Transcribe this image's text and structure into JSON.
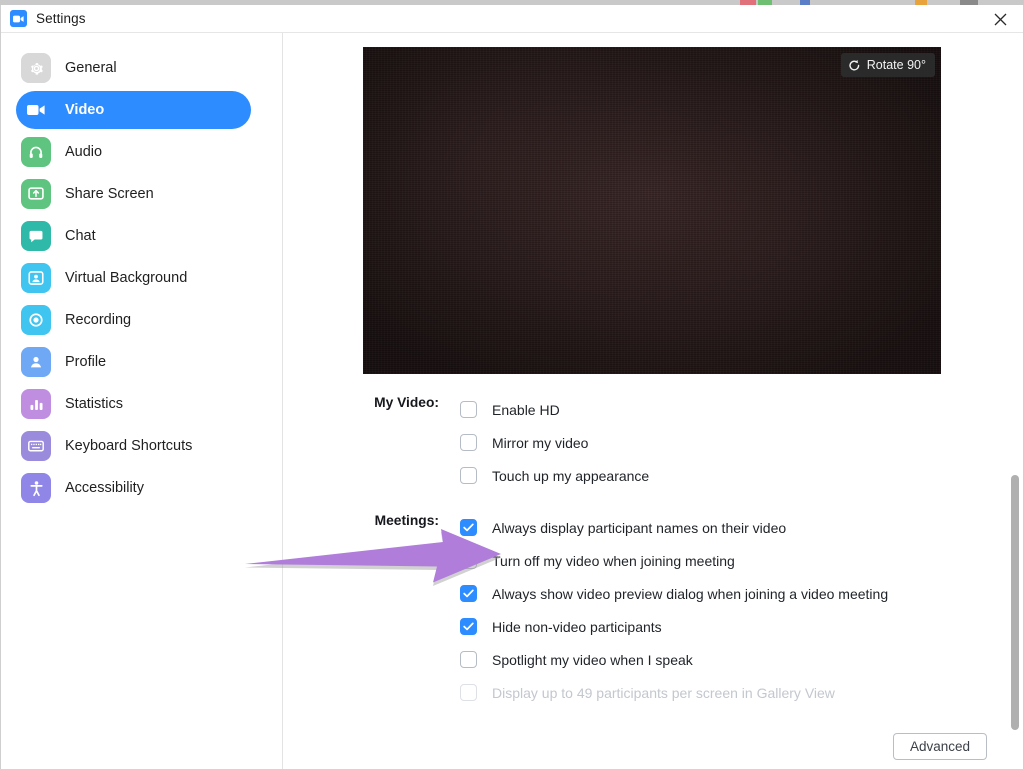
{
  "window": {
    "title": "Settings",
    "title_icon": "zoom-video-icon",
    "close_icon": "close-icon"
  },
  "colors": {
    "accent": "#2D8CFF",
    "arrow": "#b07ddb",
    "video_bg": "#2b1c1c",
    "disabled_text": "#c3c7ce"
  },
  "sidebar": {
    "items": [
      {
        "label": "General",
        "icon": "gear-icon",
        "icon_bg": "#d8d8d8",
        "active": false
      },
      {
        "label": "Video",
        "icon": "camera-icon",
        "icon_bg": "#2D8CFF",
        "active": true
      },
      {
        "label": "Audio",
        "icon": "headset-icon",
        "icon_bg": "#5ec47f",
        "active": false
      },
      {
        "label": "Share Screen",
        "icon": "upload-icon",
        "icon_bg": "#5ec47f",
        "active": false
      },
      {
        "label": "Chat",
        "icon": "chat-icon",
        "icon_bg": "#2fb9a8",
        "active": false
      },
      {
        "label": "Virtual Background",
        "icon": "person-card-icon",
        "icon_bg": "#40c4f0",
        "active": false
      },
      {
        "label": "Recording",
        "icon": "record-icon",
        "icon_bg": "#40c4f0",
        "active": false
      },
      {
        "label": "Profile",
        "icon": "person-icon",
        "icon_bg": "#6fa8f5",
        "active": false
      },
      {
        "label": "Statistics",
        "icon": "bar-chart-icon",
        "icon_bg": "#c08ee0",
        "active": false
      },
      {
        "label": "Keyboard Shortcuts",
        "icon": "keyboard-icon",
        "icon_bg": "#9b8bdd",
        "active": false
      },
      {
        "label": "Accessibility",
        "icon": "accessibility-icon",
        "icon_bg": "#8f86e8",
        "active": false
      }
    ]
  },
  "main": {
    "video_preview": {
      "rotate_button_label": "Rotate 90°",
      "rotate_icon": "rotate-ccw-icon"
    },
    "groups": [
      {
        "label": "My Video:",
        "items": [
          {
            "label": "Enable HD",
            "checked": false,
            "disabled": false
          },
          {
            "label": "Mirror my video",
            "checked": false,
            "disabled": false
          },
          {
            "label": "Touch up my appearance",
            "checked": false,
            "disabled": false
          }
        ]
      },
      {
        "label": "Meetings:",
        "items": [
          {
            "label": "Always display participant names on their video",
            "checked": true,
            "disabled": false
          },
          {
            "label": "Turn off my video when joining meeting",
            "checked": false,
            "disabled": false
          },
          {
            "label": "Always show video preview dialog when joining a video meeting",
            "checked": true,
            "disabled": false
          },
          {
            "label": "Hide non-video participants",
            "checked": true,
            "disabled": false
          },
          {
            "label": "Spotlight my video when I speak",
            "checked": false,
            "disabled": false
          },
          {
            "label": "Display up to 49 participants per screen in Gallery View",
            "checked": false,
            "disabled": true
          }
        ]
      }
    ],
    "advanced_button_label": "Advanced"
  },
  "annotation": {
    "arrow_icon": "pointer-arrow-icon",
    "points_at": "Turn off my video when joining meeting"
  }
}
